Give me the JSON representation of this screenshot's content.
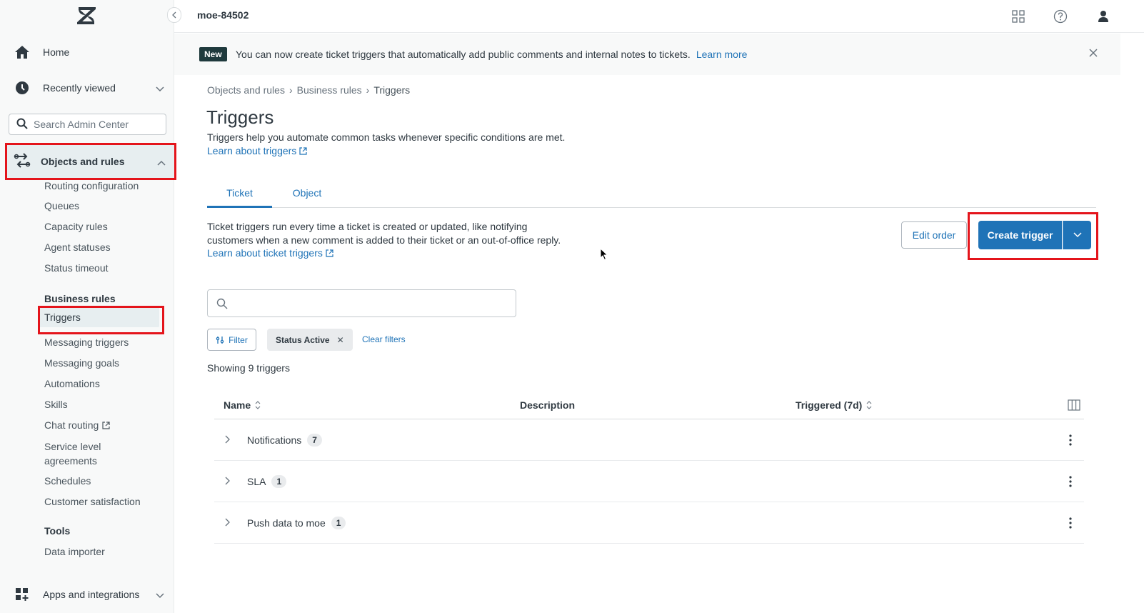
{
  "header": {
    "account_name": "moe-84502"
  },
  "sidebar": {
    "home": "Home",
    "recently_viewed": "Recently viewed",
    "search_placeholder": "Search Admin Center",
    "objects_and_rules": "Objects and rules",
    "sub_items": [
      "Routing configuration",
      "Queues",
      "Capacity rules",
      "Agent statuses",
      "Status timeout"
    ],
    "business_rules_heading": "Business rules",
    "business_rules_items": [
      "Triggers",
      "Messaging triggers",
      "Messaging goals",
      "Automations",
      "Skills",
      "Chat routing",
      "Service level",
      "agreements",
      "Schedules",
      "Customer satisfaction"
    ],
    "tools_heading": "Tools",
    "tools_items": [
      "Data importer"
    ],
    "apps_and_integrations": "Apps and integrations"
  },
  "banner": {
    "badge": "New",
    "text": "You can now create ticket triggers that automatically add public comments and internal notes to tickets.",
    "link": "Learn more"
  },
  "breadcrumb": [
    "Objects and rules",
    "Business rules",
    "Triggers"
  ],
  "page": {
    "title": "Triggers",
    "description": "Triggers help you automate common tasks whenever specific conditions are met.",
    "learn_link": "Learn about triggers"
  },
  "tabs": [
    "Ticket",
    "Object"
  ],
  "ticket_section": {
    "description_line1": "Ticket triggers run every time a ticket is created or updated, like notifying",
    "description_line2": "customers when a new comment is added to their ticket or an out-of-office reply.",
    "learn_link": "Learn about ticket triggers",
    "edit_order": "Edit order",
    "create_trigger": "Create trigger"
  },
  "filters": {
    "filter_label": "Filter",
    "status_tag": "Status Active",
    "clear": "Clear filters",
    "showing": "Showing 9 triggers"
  },
  "table": {
    "columns": [
      "Name",
      "Description",
      "Triggered (7d)"
    ],
    "rows": [
      {
        "name": "Notifications",
        "count": "7"
      },
      {
        "name": "SLA",
        "count": "1"
      },
      {
        "name": "Push data to moe",
        "count": "1"
      }
    ]
  }
}
